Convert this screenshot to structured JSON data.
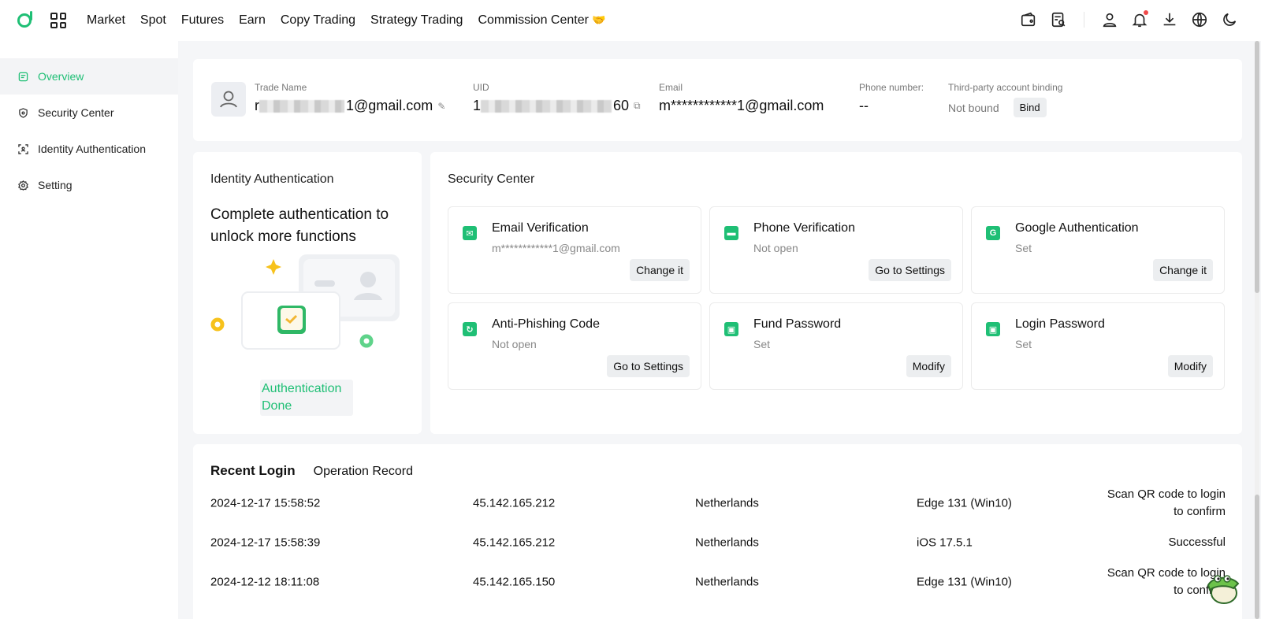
{
  "nav": {
    "items": [
      "Market",
      "Spot",
      "Futures",
      "Earn",
      "Copy Trading",
      "Strategy Trading",
      "Commission Center"
    ],
    "commission_emoji": "🤝"
  },
  "sidebar": {
    "items": [
      {
        "label": "Overview",
        "active": true
      },
      {
        "label": "Security Center"
      },
      {
        "label": "Identity Authentication"
      },
      {
        "label": "Setting"
      }
    ]
  },
  "profile": {
    "trade_name_label": "Trade Name",
    "trade_name_prefix": "r",
    "trade_name_suffix": "1@gmail.com",
    "uid_label": "UID",
    "uid_prefix": "1",
    "uid_suffix": "60",
    "email_label": "Email",
    "email_value": "m************1@gmail.com",
    "phone_label": "Phone number:",
    "phone_value": "--",
    "third_party_label": "Third-party account binding",
    "third_party_value": "Not bound",
    "bind_label": "Bind"
  },
  "identity": {
    "title": "Identity Authentication",
    "headline": "Complete authentication to unlock more functions",
    "status": "Authentication Done"
  },
  "security": {
    "title": "Security Center",
    "items": [
      {
        "title": "Email Verification",
        "sub": "m************1@gmail.com",
        "action": "Change it",
        "icon": "mail-icon"
      },
      {
        "title": "Phone Verification",
        "sub": "Not open",
        "action": "Go to Settings",
        "icon": "phone-icon"
      },
      {
        "title": "Google Authentication",
        "sub": "Set",
        "action": "Change it",
        "icon": "google-icon"
      },
      {
        "title": "Anti-Phishing Code",
        "sub": "Not open",
        "action": "Go to Settings",
        "icon": "anti-phishing-icon"
      },
      {
        "title": "Fund Password",
        "sub": "Set",
        "action": "Modify",
        "icon": "lock-icon"
      },
      {
        "title": "Login Password",
        "sub": "Set",
        "action": "Modify",
        "icon": "lock-icon"
      }
    ]
  },
  "logins": {
    "tabs": [
      "Recent Login",
      "Operation Record"
    ],
    "rows": [
      {
        "time": "2024-12-17 15:58:52",
        "ip": "45.142.165.212",
        "location": "Netherlands",
        "device": "Edge 131 (Win10)",
        "status": "Scan QR code to login to confirm"
      },
      {
        "time": "2024-12-17 15:58:39",
        "ip": "45.142.165.212",
        "location": "Netherlands",
        "device": "iOS 17.5.1",
        "status": "Successful"
      },
      {
        "time": "2024-12-12 18:11:08",
        "ip": "45.142.165.150",
        "location": "Netherlands",
        "device": "Edge 131 (Win10)",
        "status": "Scan QR code to login to confirm"
      }
    ]
  },
  "colors": {
    "accent": "#1fbf75"
  }
}
